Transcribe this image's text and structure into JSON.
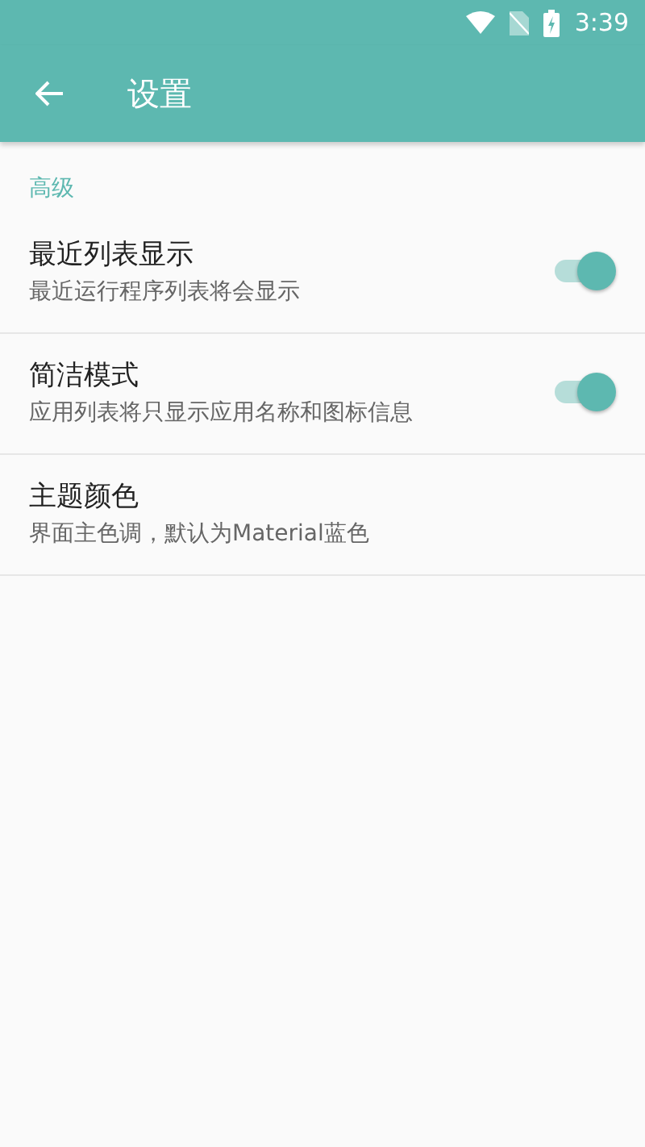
{
  "status_bar": {
    "time": "3:39"
  },
  "toolbar": {
    "title": "设置"
  },
  "section": {
    "title": "高级"
  },
  "items": [
    {
      "kind": "switch",
      "title": "最近列表显示",
      "summary": "最近运行程序列表将会显示",
      "on": true
    },
    {
      "kind": "switch",
      "title": "简洁模式",
      "summary": "应用列表将只显示应用名称和图标信息",
      "on": true
    },
    {
      "kind": "plain",
      "title": "主题颜色",
      "summary": "界面主色调，默认为Material蓝色"
    }
  ]
}
